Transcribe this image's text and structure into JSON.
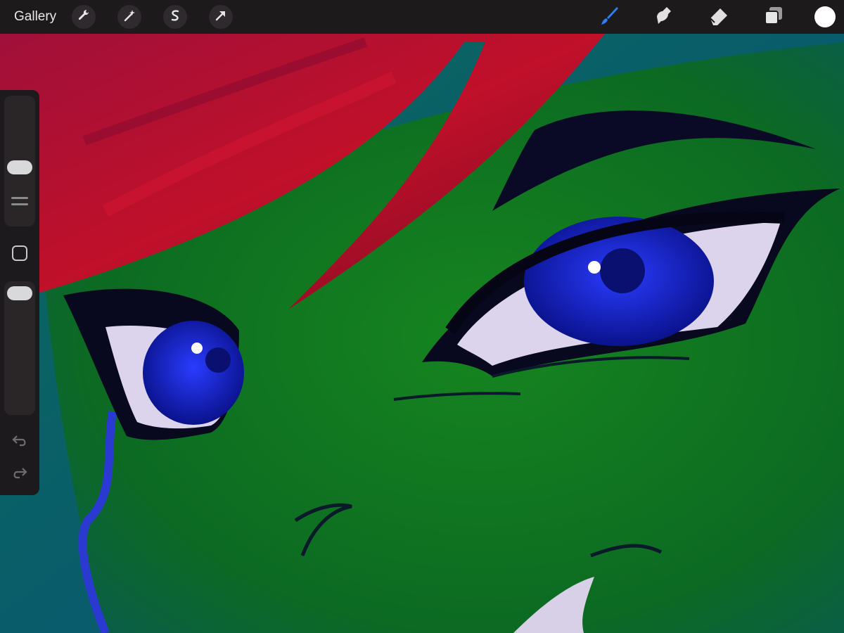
{
  "topbar": {
    "gallery_label": "Gallery",
    "tools_left": [
      {
        "icon": "wrench-icon"
      },
      {
        "icon": "magic-wand-icon"
      },
      {
        "icon": "selection-icon"
      },
      {
        "icon": "transform-arrow-icon"
      }
    ],
    "tools_right": [
      {
        "icon": "brush-icon",
        "active_color": "#2a7fff"
      },
      {
        "icon": "smudge-icon"
      },
      {
        "icon": "eraser-icon"
      },
      {
        "icon": "layers-icon"
      }
    ],
    "current_color": "#ffffff"
  },
  "sidebar": {
    "brush_size_level": 0.58,
    "opacity_level": 0.93,
    "buttons": [
      "modify-square-icon",
      "undo-icon",
      "redo-icon"
    ]
  },
  "colors": {
    "toolbar_bg": "#1d1a1c",
    "hair": "#b0102b",
    "skin": "#0f6b1f",
    "iris": "#1220c8",
    "background": "#0a5d8a"
  }
}
